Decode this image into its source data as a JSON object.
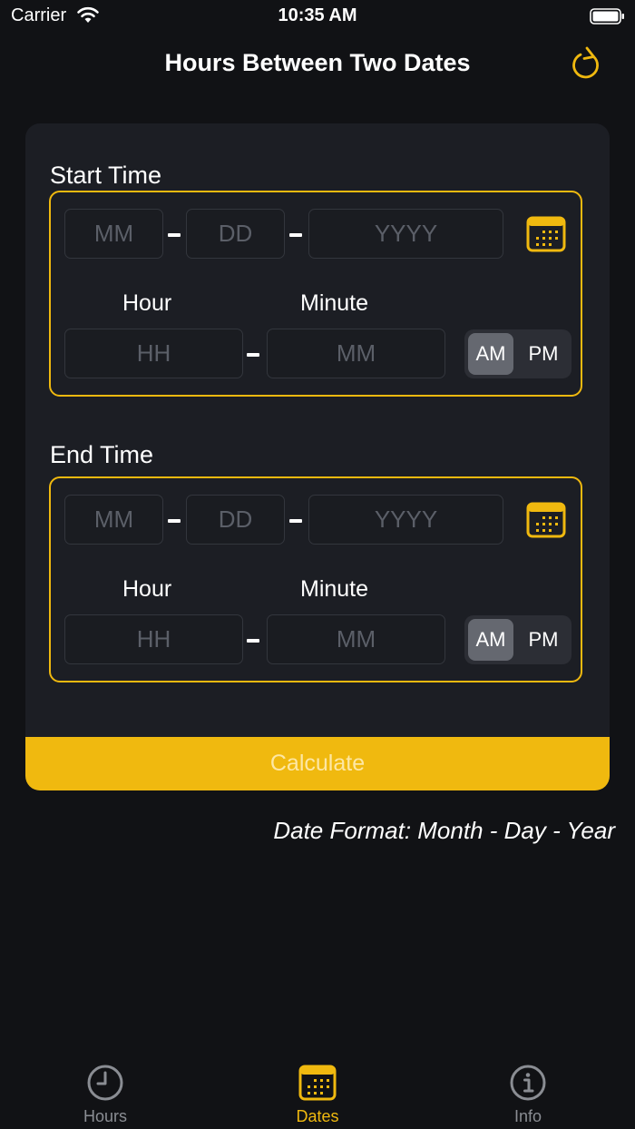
{
  "status": {
    "carrier": "Carrier",
    "time": "10:35 AM"
  },
  "nav": {
    "title": "Hours Between Two Dates",
    "refresh_icon": "refresh-icon"
  },
  "colors": {
    "accent": "#f0b90f",
    "background": "#111215",
    "card": "#1c1e24"
  },
  "start": {
    "label": "Start Time",
    "month_placeholder": "MM",
    "day_placeholder": "DD",
    "year_placeholder": "YYYY",
    "hour_label": "Hour",
    "minute_label": "Minute",
    "hour_placeholder": "HH",
    "minute_placeholder": "MM",
    "am": "AM",
    "pm": "PM",
    "selected": "AM"
  },
  "end": {
    "label": "End Time",
    "month_placeholder": "MM",
    "day_placeholder": "DD",
    "year_placeholder": "YYYY",
    "hour_label": "Hour",
    "minute_label": "Minute",
    "hour_placeholder": "HH",
    "minute_placeholder": "MM",
    "am": "AM",
    "pm": "PM",
    "selected": "AM"
  },
  "calculate_label": "Calculate",
  "note": "Date Format: Month - Day - Year",
  "tabs": [
    {
      "label": "Hours",
      "icon": "clock-icon",
      "active": false
    },
    {
      "label": "Dates",
      "icon": "calendar-icon",
      "active": true
    },
    {
      "label": "Info",
      "icon": "info-icon",
      "active": false
    }
  ]
}
